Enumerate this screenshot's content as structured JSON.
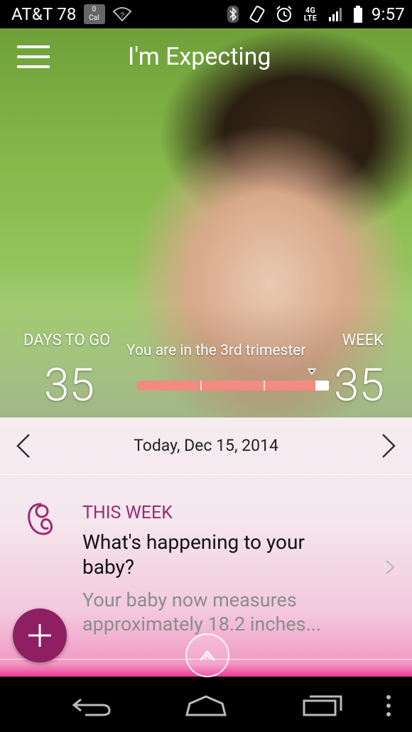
{
  "status_bar": {
    "carrier": "AT&T 78",
    "calendar_badge_top": "0",
    "calendar_badge_bottom": "Cal",
    "network": "4G LTE",
    "time": "9:57"
  },
  "app_bar": {
    "title": "I'm Expecting",
    "menu_icon": "hamburger-menu-icon"
  },
  "progress": {
    "days_label": "DAYS TO GO",
    "days_value": "35",
    "week_label": "WEEK",
    "week_value": "35",
    "trimester_text": "You are in the 3rd trimester",
    "fraction_complete": 0.93,
    "fill_color": "#f28b82"
  },
  "date_nav": {
    "date": "Today, Dec 15, 2014",
    "prev_icon": "chevron-left-icon",
    "next_icon": "chevron-right-icon"
  },
  "this_week_card": {
    "kicker": "THIS WEEK",
    "title": "What's happening to your baby?",
    "body": "Your baby now measures approximately 18.2 inches...",
    "icon": "fetus-icon"
  },
  "colors": {
    "accent": "#9a2a74",
    "fab": "#8d1f62"
  },
  "fab": {
    "icon": "plus-icon"
  },
  "system_nav": {
    "back": "back-icon",
    "home": "home-icon",
    "recents": "recents-icon",
    "overflow": "overflow-menu-icon"
  }
}
